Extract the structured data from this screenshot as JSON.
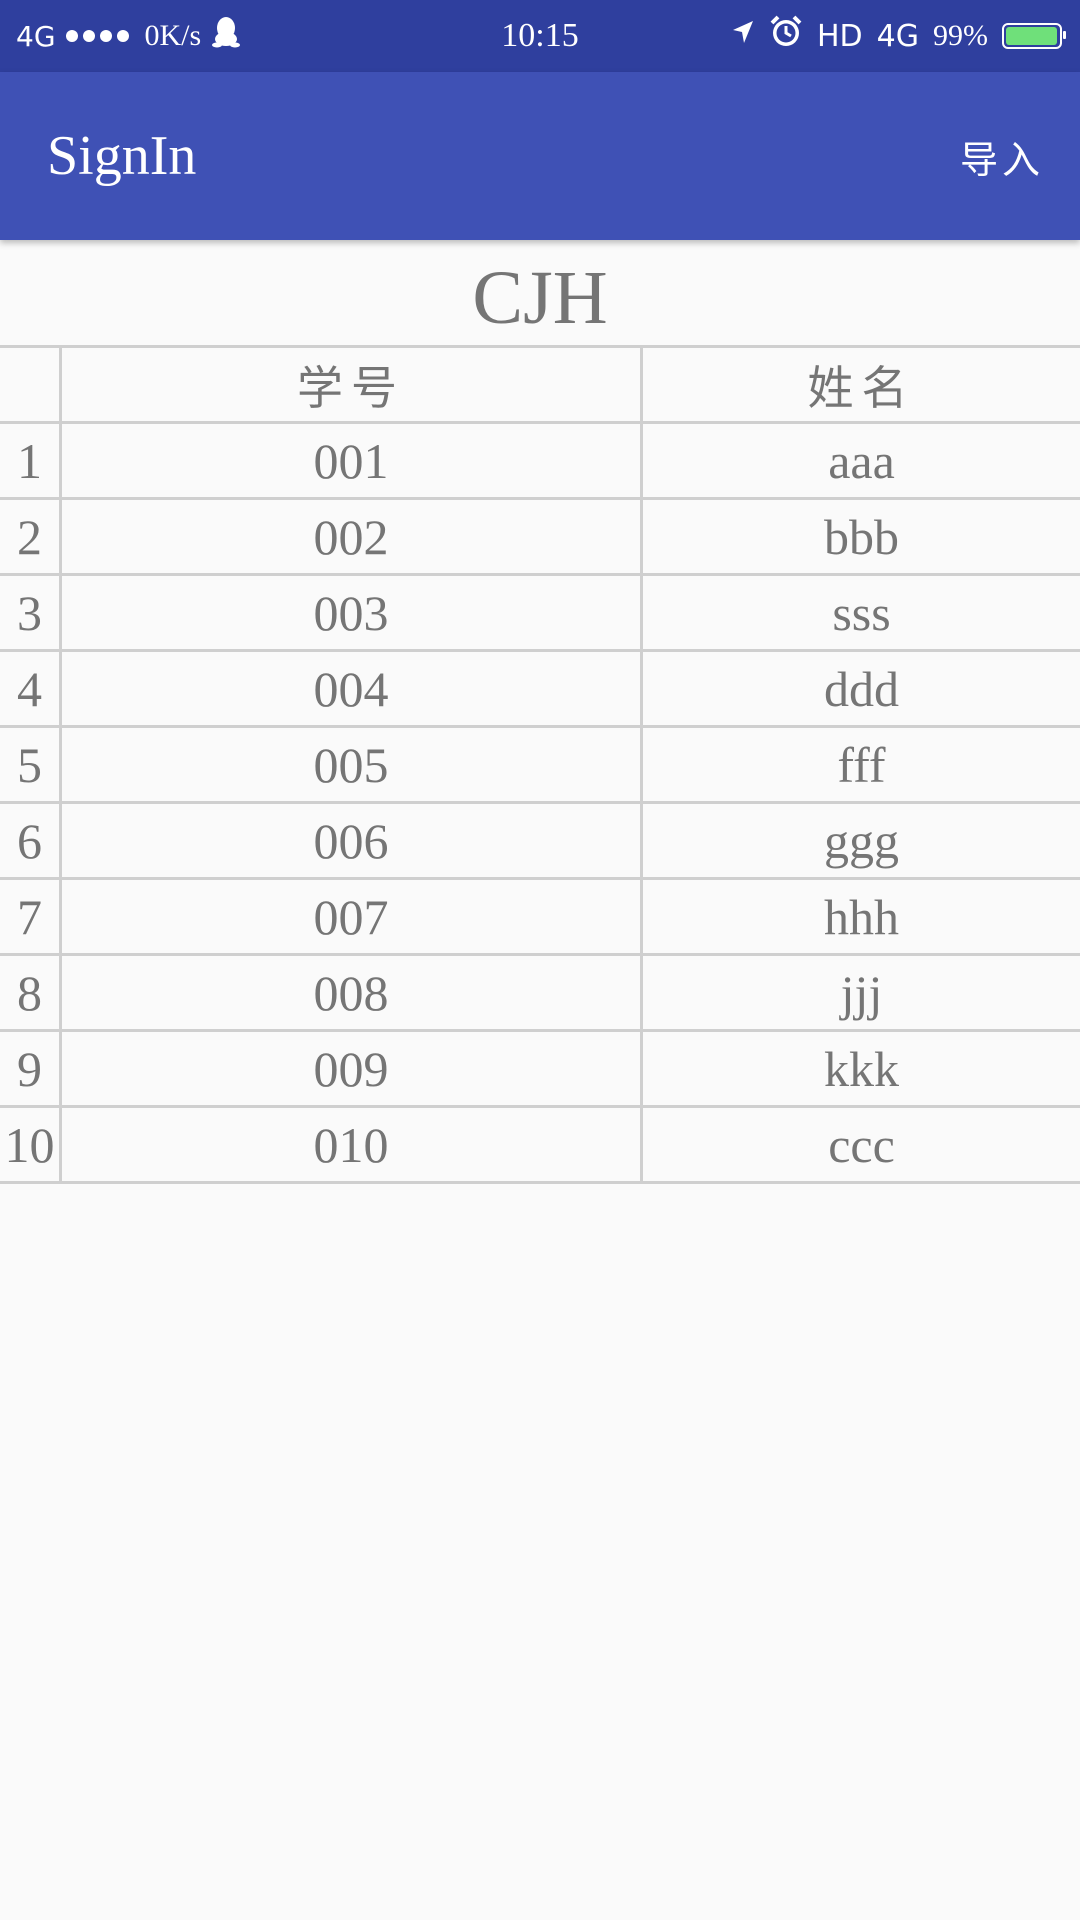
{
  "status_bar": {
    "signal_left": "4G",
    "net_speed": "0K/s",
    "time": "10:15",
    "hd": "HD",
    "signal_right": "4G",
    "battery_pct_label": "99%",
    "battery_level": 0.99,
    "battery_color": "#6fe07a",
    "icons": [
      "signal-dots-icon",
      "qq-penguin-icon",
      "location-arrow-icon",
      "alarm-clock-icon",
      "battery-icon"
    ]
  },
  "app_bar": {
    "title": "SignIn",
    "action_label": "导入",
    "color": "#3f51b5"
  },
  "table": {
    "title": "CJH",
    "headers": [
      "",
      "学号",
      "姓名"
    ],
    "rows": [
      {
        "index": "1",
        "student_no": "001",
        "name": "aaa"
      },
      {
        "index": "2",
        "student_no": "002",
        "name": "bbb"
      },
      {
        "index": "3",
        "student_no": "003",
        "name": "sss"
      },
      {
        "index": "4",
        "student_no": "004",
        "name": "ddd"
      },
      {
        "index": "5",
        "student_no": "005",
        "name": "fff"
      },
      {
        "index": "6",
        "student_no": "006",
        "name": "ggg"
      },
      {
        "index": "7",
        "student_no": "007",
        "name": "hhh"
      },
      {
        "index": "8",
        "student_no": "008",
        "name": "jjj"
      },
      {
        "index": "9",
        "student_no": "009",
        "name": "kkk"
      },
      {
        "index": "10",
        "student_no": "010",
        "name": "ccc"
      }
    ]
  }
}
